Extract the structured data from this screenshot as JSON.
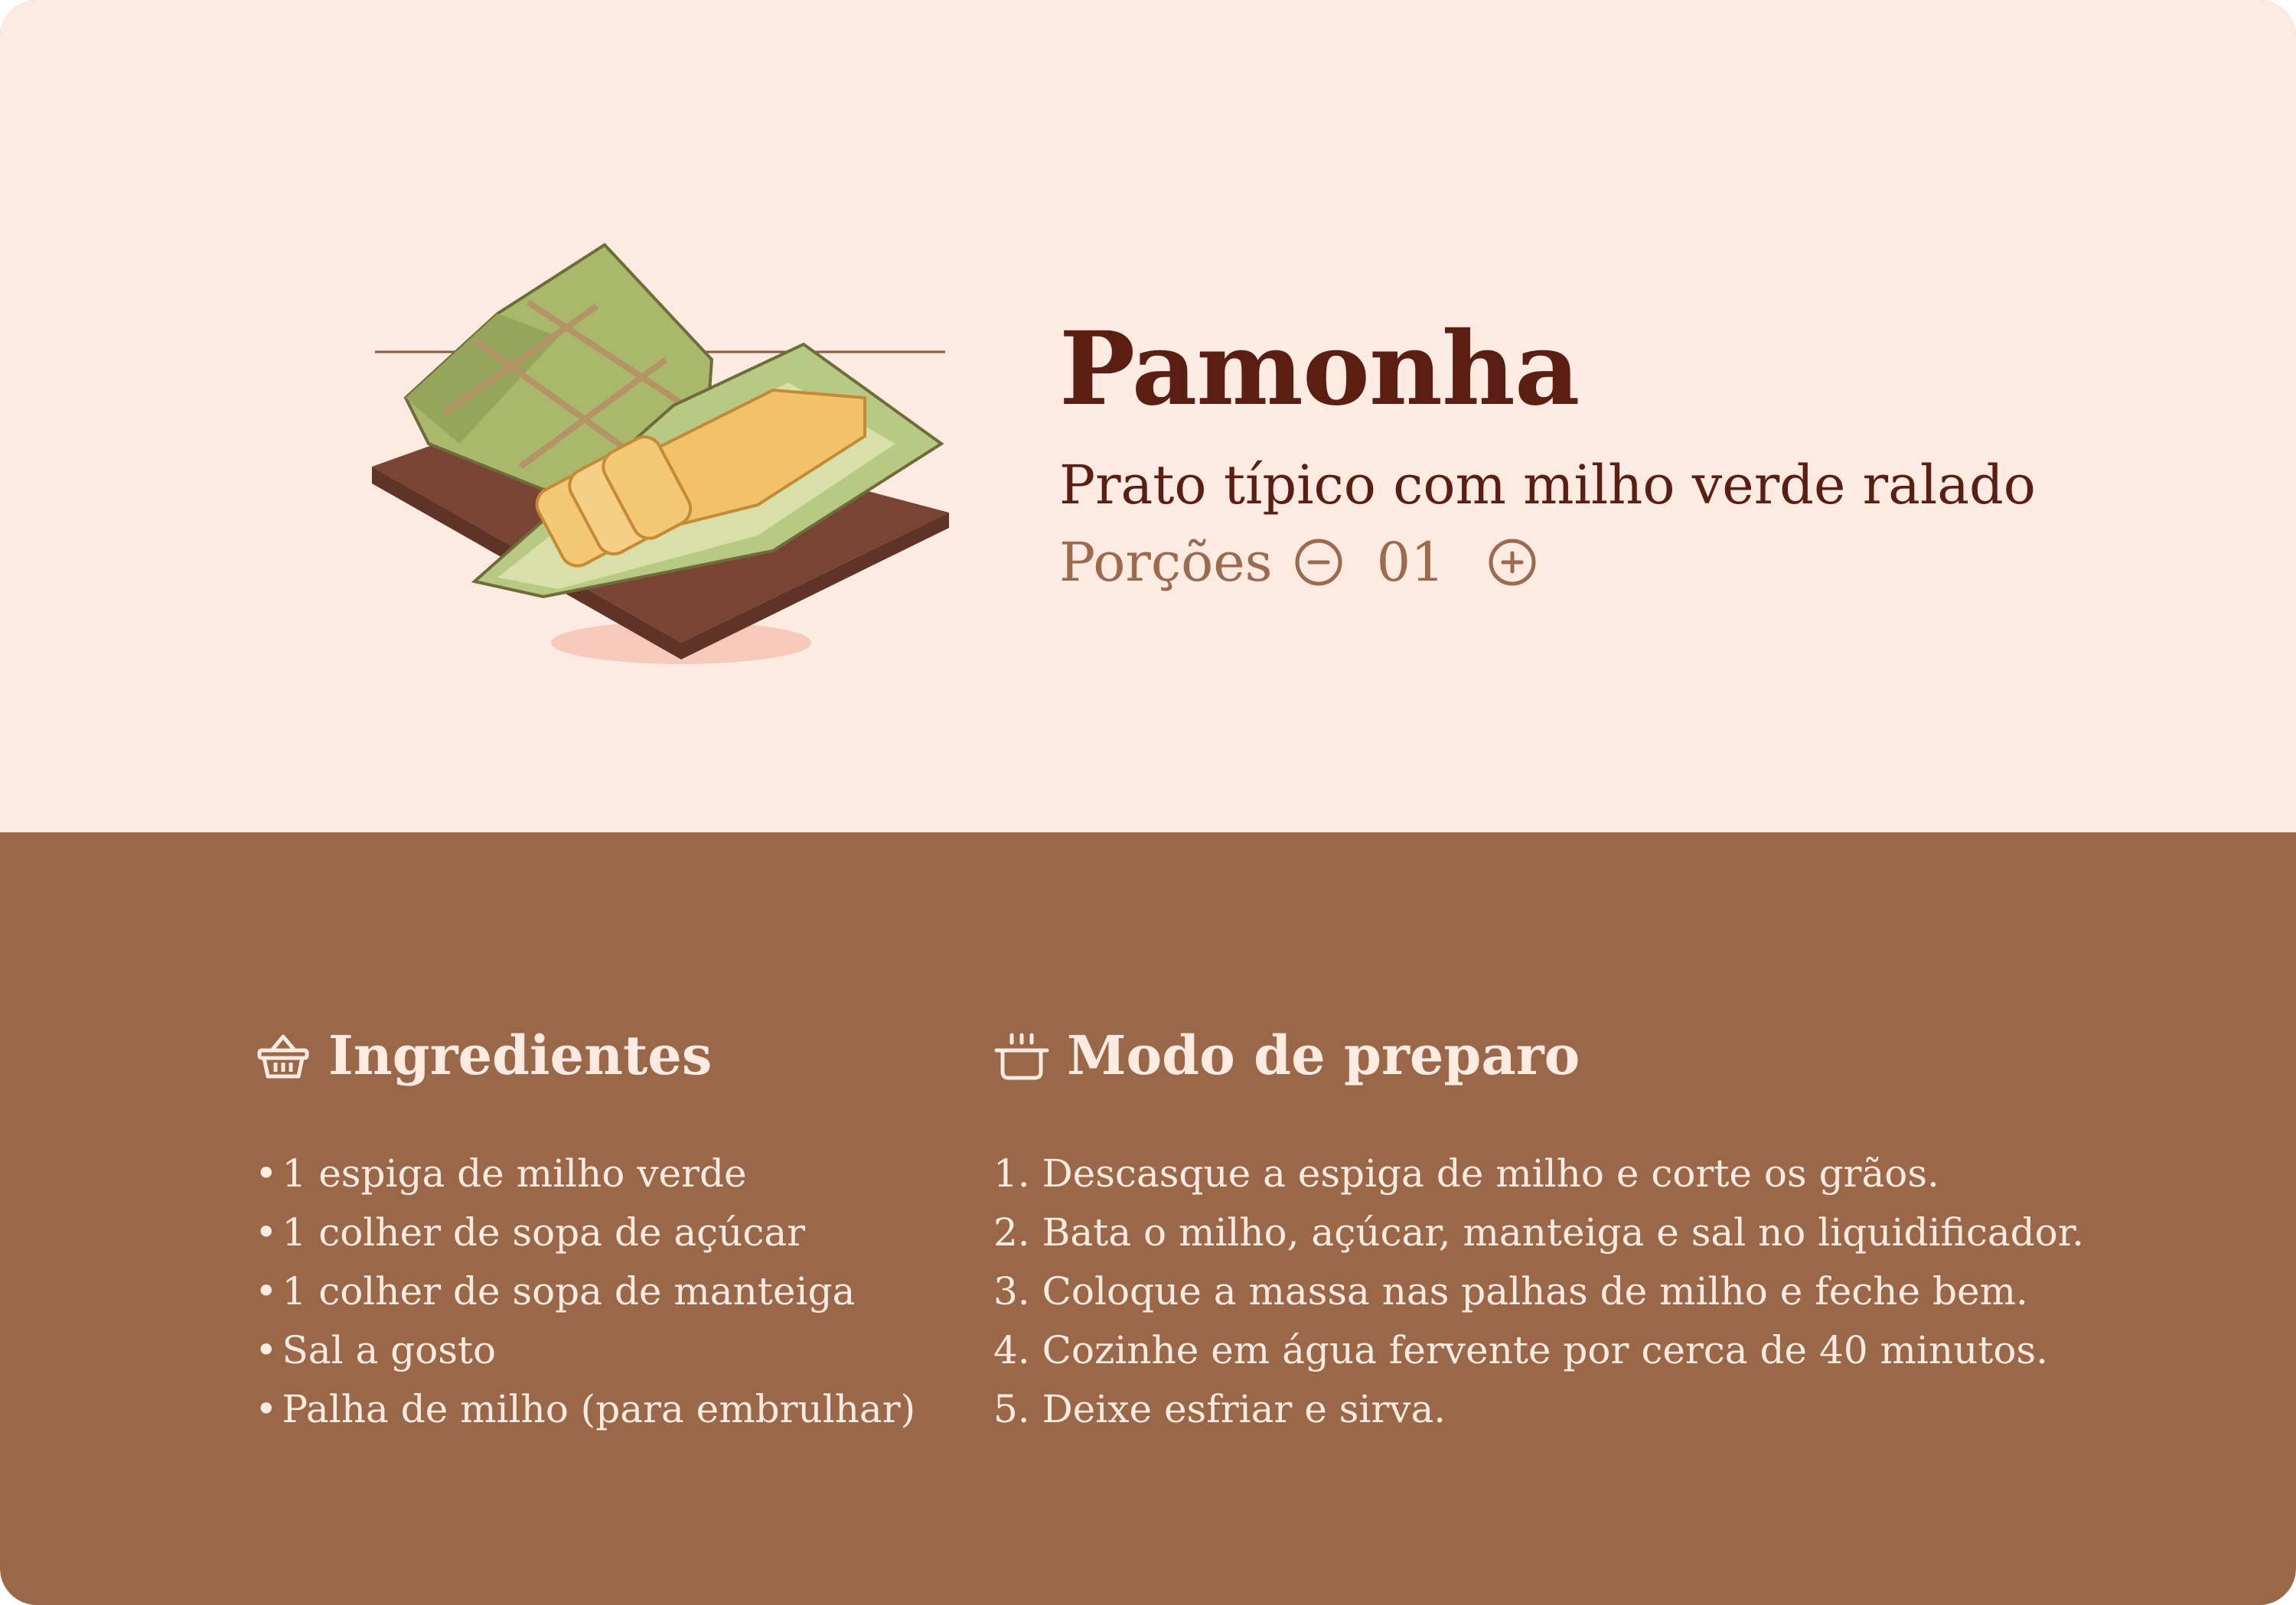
{
  "recipe": {
    "title": "Pamonha",
    "subtitle": "Prato típico com milho verde ralado",
    "servings": {
      "label": "Porções",
      "value": "01"
    }
  },
  "icons": {
    "decrease": "minus-circle-icon",
    "increase": "plus-circle-icon",
    "ingredients": "basket-icon",
    "preparo": "cooking-pot-icon"
  },
  "ingredients": {
    "title": "Ingredientes",
    "items": [
      "1 espiga de milho verde",
      "1 colher de sopa de açúcar",
      "1 colher de sopa de manteiga",
      "Sal a gosto",
      "Palha de milho (para embrulhar)"
    ]
  },
  "preparo": {
    "title": "Modo de preparo",
    "steps": [
      "1. Descasque a espiga de milho e corte os grãos.",
      "2. Bata o milho, açúcar, manteiga e sal no liquidificador.",
      "3. Coloque a massa nas palhas de milho e feche bem.",
      "4. Cozinhe em água fervente por cerca de 40 minutos.",
      "5. Deixe esfriar e sirva."
    ]
  },
  "colors": {
    "hero_background": "#fdeae0",
    "body_background": "#9b6749",
    "title": "#5a1f12",
    "muted": "#9b6a4f"
  }
}
